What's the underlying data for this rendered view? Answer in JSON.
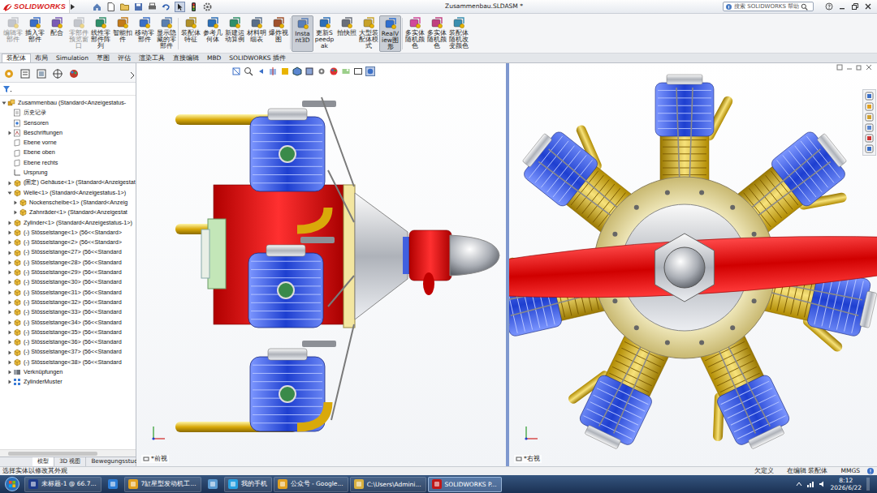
{
  "window": {
    "app": "SOLIDWORKS",
    "title": "Zusammenbau.SLDASM *"
  },
  "search": {
    "placeholder": "搜索 SOLIDWORKS 帮助"
  },
  "ribbon": [
    {
      "label": "编辑零部件",
      "disabled": true,
      "selected": false
    },
    {
      "label": "插入零部件",
      "disabled": false,
      "selected": false
    },
    {
      "label": "配合",
      "disabled": false,
      "selected": false
    },
    {
      "label": "零部件预览窗口",
      "disabled": true,
      "selected": false
    },
    {
      "label": "线性零部件阵列",
      "disabled": false,
      "selected": false
    },
    {
      "label": "智能扣件",
      "disabled": false,
      "selected": false
    },
    {
      "label": "移动零部件",
      "disabled": false,
      "selected": false
    },
    {
      "label": "显示隐藏的零部件",
      "disabled": false,
      "selected": false
    },
    {
      "label": "装配体特征",
      "disabled": false,
      "selected": false
    },
    {
      "label": "参考几何体",
      "disabled": false,
      "selected": false
    },
    {
      "label": "新建运动算例",
      "disabled": false,
      "selected": false
    },
    {
      "label": "材料明细表",
      "disabled": false,
      "selected": false
    },
    {
      "label": "爆炸视图",
      "disabled": false,
      "selected": false
    },
    {
      "label": "Instant3D",
      "disabled": false,
      "selected": true
    },
    {
      "label": "更新Speedpak",
      "disabled": false,
      "selected": false
    },
    {
      "label": "拍快照",
      "disabled": false,
      "selected": false
    },
    {
      "label": "大型装配体模式",
      "disabled": false,
      "selected": false
    },
    {
      "label": "RealView图形",
      "disabled": false,
      "selected": true
    },
    {
      "label": "多实体随机颜色",
      "disabled": false,
      "selected": false
    },
    {
      "label": "多实体随机颜色",
      "disabled": false,
      "selected": false
    },
    {
      "label": "装配体随机改变颜色",
      "disabled": false,
      "selected": false
    }
  ],
  "command_tabs": [
    {
      "label": "装配体",
      "selected": true
    },
    {
      "label": "布局",
      "selected": false
    },
    {
      "label": "Simulation",
      "selected": false
    },
    {
      "label": "草图",
      "selected": false
    },
    {
      "label": "评估",
      "selected": false
    },
    {
      "label": "渲染工具",
      "selected": false
    },
    {
      "label": "直接编辑",
      "selected": false
    },
    {
      "label": "MBD",
      "selected": false
    },
    {
      "label": "SOLIDWORKS 插件",
      "selected": false
    }
  ],
  "tree": {
    "label": "Zusammenbau  (Standard<Anzeigestatus-",
    "kind": "assembly",
    "expandable": true,
    "expanded": true,
    "children": [
      {
        "label": "历史记录",
        "kind": "history",
        "expandable": false,
        "expanded": false
      },
      {
        "label": "Sensoren",
        "kind": "sensor",
        "expandable": false,
        "expanded": false
      },
      {
        "label": "Beschriftungen",
        "kind": "annotation",
        "expandable": true,
        "expanded": false
      },
      {
        "label": "Ebene vorne",
        "kind": "plane",
        "expandable": false,
        "expanded": false
      },
      {
        "label": "Ebene oben",
        "kind": "plane",
        "expandable": false,
        "expanded": false
      },
      {
        "label": "Ebene rechts",
        "kind": "plane",
        "expandable": false,
        "expanded": false
      },
      {
        "label": "Ursprung",
        "kind": "origin",
        "expandable": false,
        "expanded": false
      },
      {
        "label": "(固定) Gehäuse<1> (Standard<Anzeigestat",
        "kind": "part",
        "expandable": true,
        "expanded": false
      },
      {
        "label": "Welle<1> (Standard<Anzeigestatus-1>)",
        "kind": "part",
        "expandable": true,
        "expanded": true,
        "children": [
          {
            "label": "Nockenscheibe<1> (Standard<Anzeig",
            "kind": "part",
            "expandable": true,
            "expanded": false
          },
          {
            "label": "Zahnräder<1> (Standard<Anzeigestat",
            "kind": "part",
            "expandable": true,
            "expanded": false
          }
        ]
      },
      {
        "label": "Zylinder<1> (Standard<Anzeigestatus-1>)",
        "kind": "part",
        "expandable": true,
        "expanded": false
      },
      {
        "label": "(-) Stösselstange<1> (56<<Standard>",
        "kind": "part",
        "expandable": true,
        "expanded": false
      },
      {
        "label": "(-) Stösselstange<2> (56<<Standard>",
        "kind": "part",
        "expandable": true,
        "expanded": false
      },
      {
        "label": "(-) Stösselstange<27> (56<<Standard",
        "kind": "part",
        "expandable": true,
        "expanded": false
      },
      {
        "label": "(-) Stösselstange<28> (56<<Standard",
        "kind": "part",
        "expandable": true,
        "expanded": false
      },
      {
        "label": "(-) Stösselstange<29> (56<<Standard",
        "kind": "part",
        "expandable": true,
        "expanded": false
      },
      {
        "label": "(-) Stösselstange<30> (56<<Standard",
        "kind": "part",
        "expandable": true,
        "expanded": false
      },
      {
        "label": "(-) Stösselstange<31> (56<<Standard",
        "kind": "part",
        "expandable": true,
        "expanded": false
      },
      {
        "label": "(-) Stösselstange<32> (56<<Standard",
        "kind": "part",
        "expandable": true,
        "expanded": false
      },
      {
        "label": "(-) Stösselstange<33> (56<<Standard",
        "kind": "part",
        "expandable": true,
        "expanded": false
      },
      {
        "label": "(-) Stösselstange<34> (56<<Standard",
        "kind": "part",
        "expandable": true,
        "expanded": false
      },
      {
        "label": "(-) Stösselstange<35> (56<<Standard",
        "kind": "part",
        "expandable": true,
        "expanded": false
      },
      {
        "label": "(-) Stösselstange<36> (56<<Standard",
        "kind": "part",
        "expandable": true,
        "expanded": false
      },
      {
        "label": "(-) Stösselstange<37> (56<<Standard",
        "kind": "part",
        "expandable": true,
        "expanded": false
      },
      {
        "label": "(-) Stösselstange<38> (56<<Standard",
        "kind": "part",
        "expandable": true,
        "expanded": false
      },
      {
        "label": "Verknüpfungen",
        "kind": "mates",
        "expandable": true,
        "expanded": false
      },
      {
        "label": "ZylinderMuster",
        "kind": "pattern",
        "expandable": true,
        "expanded": false
      }
    ]
  },
  "panel_tabs": [
    {
      "label": "模型",
      "selected": true
    },
    {
      "label": "3D 视图",
      "selected": false
    },
    {
      "label": "Bewegungsstudie 1",
      "selected": false
    }
  ],
  "viewports": [
    {
      "label": "*前视"
    },
    {
      "label": "*右视"
    }
  ],
  "status_bar": {
    "message": "选择实体以修改其外观",
    "items": [
      "欠定义",
      "在编辑 装配体",
      "MMGS"
    ]
  },
  "taskbar": {
    "apps": [
      {
        "kind": "button",
        "label": "未标题-1 @ 66.7...",
        "selected": false
      },
      {
        "kind": "icon",
        "selected": false
      },
      {
        "kind": "button",
        "label": "7缸星型发动机工...",
        "selected": false
      },
      {
        "kind": "icon",
        "selected": false
      },
      {
        "kind": "button",
        "label": "我的手机",
        "selected": false
      },
      {
        "kind": "button",
        "label": "公众号 - Google...",
        "selected": false
      },
      {
        "kind": "button",
        "label": "C:\\Users\\Admini...",
        "selected": false
      },
      {
        "kind": "button",
        "label": "SOLIDWORKS P...",
        "selected": true
      }
    ],
    "time": "8:12",
    "date": "2026/6/22"
  }
}
